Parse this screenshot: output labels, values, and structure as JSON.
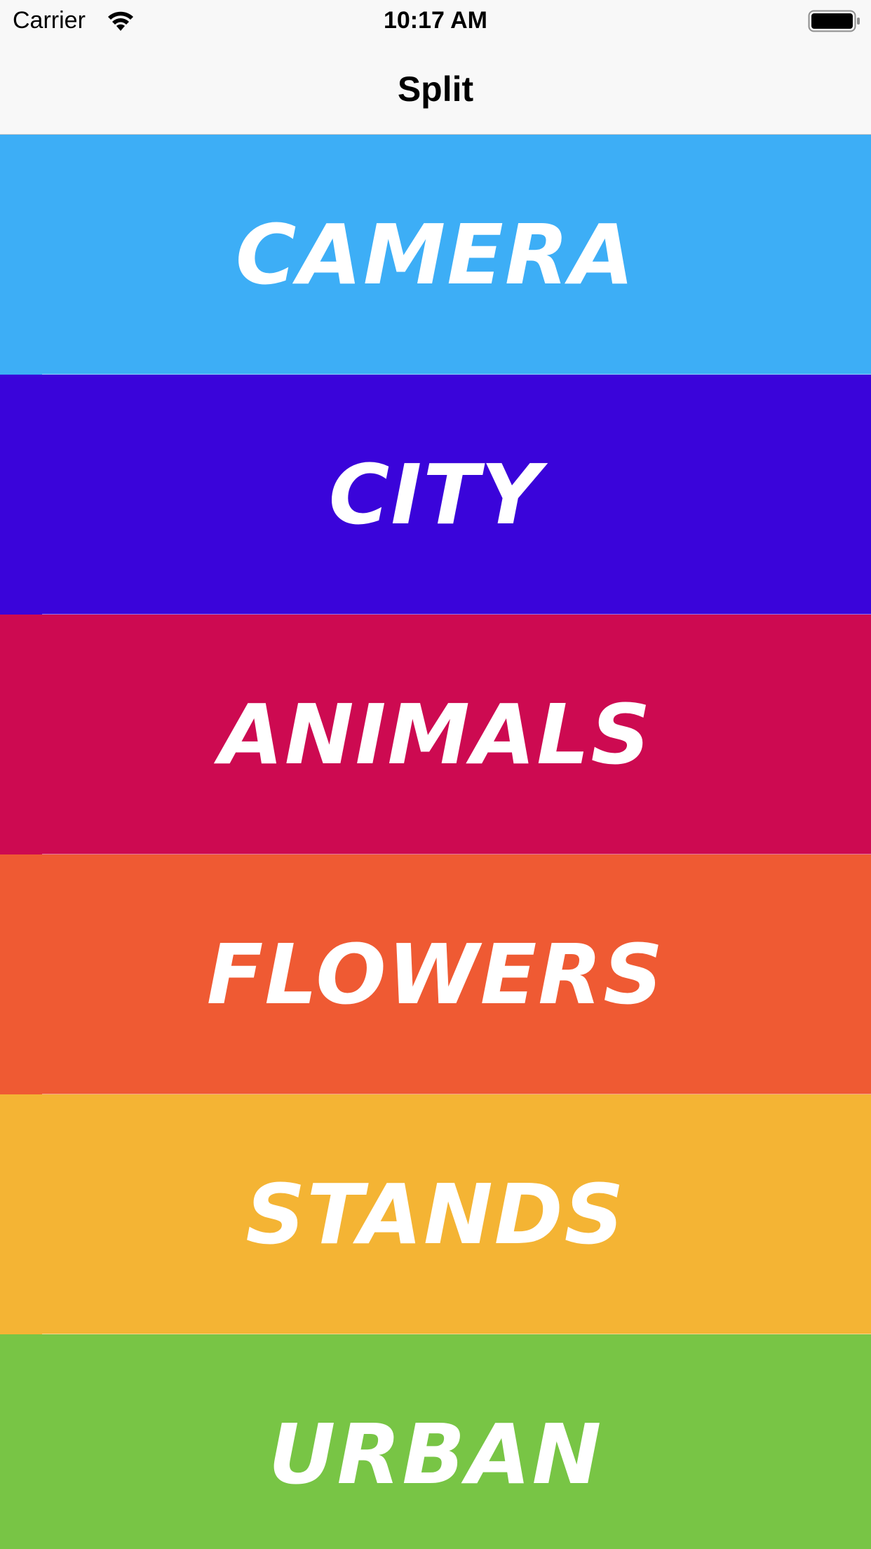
{
  "status_bar": {
    "carrier": "Carrier",
    "time": "10:17 AM",
    "wifi_icon": "wifi-icon",
    "battery_icon": "battery-full-icon"
  },
  "nav": {
    "title": "Split"
  },
  "categories": [
    {
      "label": "CAMERA",
      "color": "#3DAEF6"
    },
    {
      "label": "CITY",
      "color": "#3A04DA"
    },
    {
      "label": "ANIMALS",
      "color": "#CD0A51"
    },
    {
      "label": "FLOWERS",
      "color": "#EF5A33"
    },
    {
      "label": "STANDS",
      "color": "#F4B434"
    },
    {
      "label": "URBAN",
      "color": "#78C545"
    }
  ]
}
